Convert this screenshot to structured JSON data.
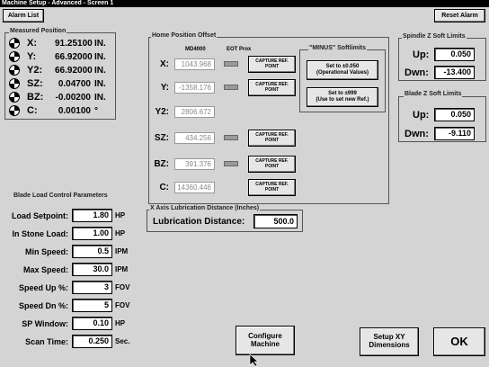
{
  "window": {
    "title": "Machine Setup - Advanced - Screen 1"
  },
  "toolbar": {
    "alarm_list": "Alarm List",
    "reset_alarm": "Reset Alarm"
  },
  "measured": {
    "title": "Measured Position",
    "rows": [
      {
        "label": "X:",
        "value": "91.25100",
        "unit": "IN."
      },
      {
        "label": "Y:",
        "value": "66.92000",
        "unit": "IN."
      },
      {
        "label": "Y2:",
        "value": "66.92000",
        "unit": "IN."
      },
      {
        "label": "SZ:",
        "value": "0.04700",
        "unit": "IN."
      },
      {
        "label": "BZ:",
        "value": "-0.00200",
        "unit": "IN."
      },
      {
        "label": "C:",
        "value": "0.00100",
        "unit": "°"
      }
    ]
  },
  "home": {
    "title": "Home Position Offset",
    "col_md": "MD4000",
    "col_eot": "EOT Prox",
    "capture_label": "CAPTURE REF.\nPOINT",
    "rows": [
      {
        "label": "X:",
        "value": "1043.968"
      },
      {
        "label": "Y:",
        "value": "-1358.176"
      },
      {
        "label": "Y2:",
        "value": "2806.672"
      },
      {
        "label": "SZ:",
        "value": "434.256"
      },
      {
        "label": "BZ:",
        "value": "391.376"
      },
      {
        "label": "C:",
        "value": "14360.446"
      }
    ]
  },
  "minus": {
    "title": "\"MINUS\" Softlimits",
    "btn1": "Set to ±0.050\n(Operational Values)",
    "btn2": "Set to ±999\n(Use to set new Ref.)"
  },
  "spindle": {
    "title": "Spindle Z Soft Limits",
    "up_label": "Up:",
    "up_value": "0.050",
    "dwn_label": "Dwn:",
    "dwn_value": "-13.400"
  },
  "blade_z": {
    "title": "Blade Z Soft Limits",
    "up_label": "Up:",
    "up_value": "0.050",
    "dwn_label": "Dwn:",
    "dwn_value": "-9.110"
  },
  "blade_load": {
    "title": "Blade Load Control Parameters",
    "rows": [
      {
        "label": "Load Setpoint:",
        "value": "1.80",
        "unit": "HP"
      },
      {
        "label": "In Stone Load:",
        "value": "1.00",
        "unit": "HP"
      },
      {
        "label": "Min Speed:",
        "value": "0.5",
        "unit": "IPM"
      },
      {
        "label": "Max Speed:",
        "value": "30.0",
        "unit": "IPM"
      },
      {
        "label": "Speed Up %:",
        "value": "3",
        "unit": "FOV"
      },
      {
        "label": "Speed Dn %:",
        "value": "5",
        "unit": "FOV"
      },
      {
        "label": "SP Window:",
        "value": "0.10",
        "unit": "HP"
      },
      {
        "label": "Scan Time:",
        "value": "0.250",
        "unit": "Sec."
      }
    ]
  },
  "lube": {
    "title": "X Axis Lubrication Distance (Inches)",
    "label": "Lubrication Distance:",
    "value": "500.0"
  },
  "bottom": {
    "configure": "Configure\nMachine",
    "setup_xy": "Setup XY\nDimensions",
    "ok": "OK"
  },
  "colors": {
    "background": "#d4d4d4",
    "titlebar": "#000000",
    "button_face": "#e6e6e6",
    "field": "#ffffff"
  }
}
